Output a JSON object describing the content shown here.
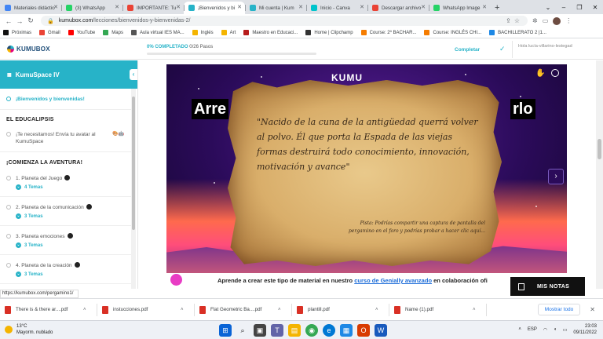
{
  "browser": {
    "tabs": [
      {
        "title": "Materiales didácticos",
        "color": "#4285f4"
      },
      {
        "title": "(3) WhatsApp",
        "color": "#25d366"
      },
      {
        "title": "IMPORTANTE: Tu",
        "color": "#ea4335"
      },
      {
        "title": "¡Bienvenidos y bi",
        "color": "#27b3c8",
        "active": true
      },
      {
        "title": "Mi cuenta | Kum",
        "color": "#27b3c8"
      },
      {
        "title": "Inicio - Canva",
        "color": "#00c4cc"
      },
      {
        "title": "Descargar archivo",
        "color": "#ea4335"
      },
      {
        "title": "WhatsApp Image",
        "color": "#25d366"
      }
    ],
    "url_domain": "kumubox.com",
    "url_path": "/lecciones/bienvenidos-y-bienvenidas-2/",
    "bookmarks": [
      {
        "label": "Próximas",
        "color": "#111"
      },
      {
        "label": "Gmail",
        "color": "#ea4335"
      },
      {
        "label": "YouTube",
        "color": "#ff0000"
      },
      {
        "label": "Maps",
        "color": "#34a853"
      },
      {
        "label": "Aula virtual IES MA...",
        "color": "#555"
      },
      {
        "label": "Inglés",
        "color": "#f4b400"
      },
      {
        "label": "Art",
        "color": "#f4b400"
      },
      {
        "label": "Maestro en Educaci...",
        "color": "#b71c1c"
      },
      {
        "label": "Home | Clipchamp",
        "color": "#333"
      },
      {
        "label": "Course: 2º BACHAR...",
        "color": "#f57c00"
      },
      {
        "label": "Course: INGLÉS CHI...",
        "color": "#f57c00"
      },
      {
        "label": "BACHILLERATO 2 |1...",
        "color": "#1e88e5"
      }
    ],
    "status_url": "https://kumubox.com/pergamino1/"
  },
  "course_header": {
    "logo": "KUMUBOX",
    "progress_percent": "0% COMPLETADO",
    "progress_steps": "0/26 Pasos",
    "progress_fraction": 0,
    "complete_label": "Completar",
    "greeting": "Hola lucía-villarino-lestegad"
  },
  "sidebar": {
    "title": "KumuSpace IV",
    "welcome_item": "¡Bienvenidos y bienvenidas!",
    "section1": "EL EDUCALIPSIS",
    "avatar_item": "¡Te necesitamos! Envía tu avatar al KumuSpace",
    "section2": "¡COMIENZA LA AVENTURA!",
    "lessons": [
      {
        "label": "1. Planeta del Juego",
        "topics": "4 Temas"
      },
      {
        "label": "2. Planeta de la comunicación",
        "topics": "3 Temas"
      },
      {
        "label": "3. Planeta emociones",
        "topics": "3 Temas"
      },
      {
        "label": "4. Planeta de la creación",
        "topics": "3 Temas"
      }
    ]
  },
  "content": {
    "title_left": "Arre",
    "title_right": "rlo",
    "genially_logo": "KUMU",
    "quote": "\"Nacido de la cuna de la antigüedad querrá volver al polvo. Él que porta la Espada de las viejas formas destruirá todo conocimiento, innovación, motivación y avance\"",
    "hint": "Pista: Podrías compartir una captura de pantalla del pergamino en el foro y podrías probar a hacer clic aquí...",
    "cta_pre": "Aprende a crear este tipo de material en nuestro ",
    "cta_link": "curso de Genially avanzado",
    "cta_post": " en colaboración ofi",
    "notes_label": "MIS NOTAS"
  },
  "downloads": {
    "items": [
      "There is & there ar....pdf",
      "instucciones.pdf",
      "Flat Geometric Ba....pdf",
      "plantill.pdf",
      "Name (1).pdf"
    ],
    "show_all": "Mostrar todo"
  },
  "taskbar": {
    "temp": "13°C",
    "weather": "Mayorm. nublado",
    "lang": "ESP",
    "time": "23:03",
    "date": "09/11/2022"
  }
}
